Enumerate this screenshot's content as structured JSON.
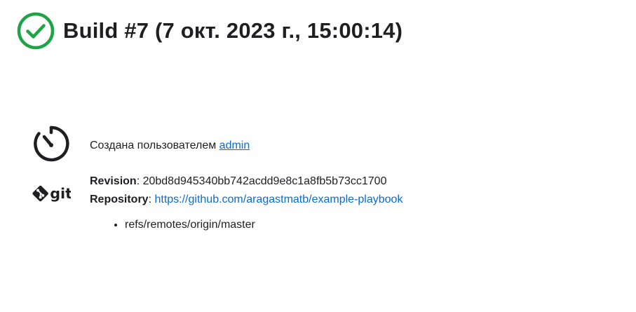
{
  "build": {
    "title": "Build #7 (7 окт. 2023 г., 15:00:14)",
    "status_icon": "check-circle-icon",
    "status_color": "#1ea446"
  },
  "cause": {
    "icon": "timer-icon",
    "text": "Создана пользователем ",
    "user": "admin"
  },
  "git": {
    "icon": "git-logo-icon",
    "revision_label": "Revision",
    "revision_value": "20bd8d945340bb742acdd9e8c1a8fb5b73cc1700",
    "repository_label": "Repository",
    "repository_url": "https://github.com/aragastmatb/example-playbook",
    "branches": [
      "refs/remotes/origin/master"
    ]
  },
  "colors": {
    "link": "#0b6bcb",
    "text": "#1f1f23"
  }
}
